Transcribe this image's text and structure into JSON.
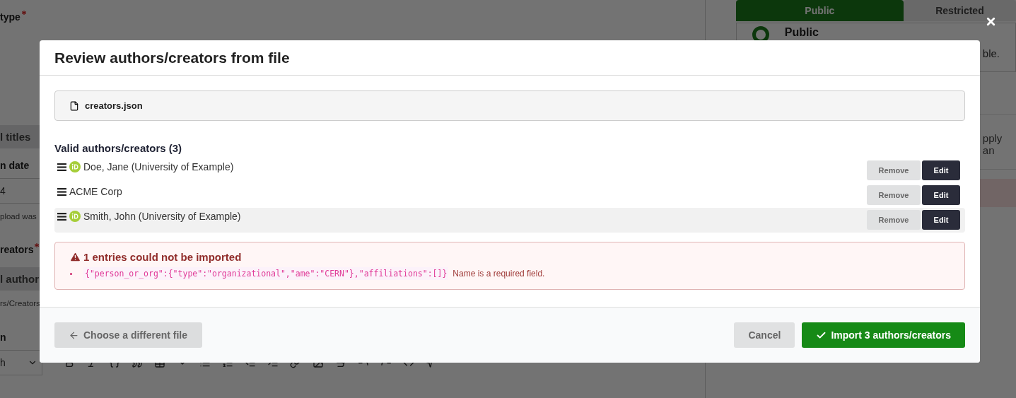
{
  "background": {
    "form_fragments": [
      {
        "kind": "label",
        "text": "type",
        "required": true
      },
      {
        "kind": "button",
        "text": "l titles",
        "required": false
      },
      {
        "kind": "label",
        "text": "n date",
        "required": false
      },
      {
        "kind": "input",
        "text": "4",
        "required": false
      },
      {
        "kind": "help",
        "text": "pload was",
        "required": false
      },
      {
        "kind": "label",
        "text": "reators",
        "required": true
      },
      {
        "kind": "button",
        "text": "l author",
        "required": false
      },
      {
        "kind": "help",
        "text": "rs/Creators",
        "required": false
      },
      {
        "kind": "label",
        "text": "n",
        "required": false
      },
      {
        "kind": "select",
        "text": "h",
        "required": false
      }
    ],
    "access_panel": {
      "tabs": [
        {
          "label": "Public",
          "selected": true
        },
        {
          "label": "Restricted",
          "selected": false
        }
      ],
      "option_title": "Public",
      "option_text": "ble.",
      "note": "pply an"
    }
  },
  "modal": {
    "title": "Review authors/creators from file",
    "file_name": "creators.json",
    "section_title": "Valid authors/creators (3)",
    "creators": [
      {
        "name": "Doe, Jane (University of Example)",
        "orcid": true,
        "selected": false,
        "remove_label": "Remove",
        "edit_label": "Edit"
      },
      {
        "name": "ACME Corp",
        "orcid": false,
        "selected": false,
        "remove_label": "Remove",
        "edit_label": "Edit"
      },
      {
        "name": "Smith, John (University of Example)",
        "orcid": true,
        "selected": true,
        "remove_label": "Remove",
        "edit_label": "Edit"
      }
    ],
    "error": {
      "title": "1 entries could not be imported",
      "items": [
        {
          "code": "{\"person_or_org\":{\"type\":\"organizational\",\"ame\":\"CERN\"},\"affiliations\":[]}",
          "message": "Name is a required field."
        }
      ]
    },
    "footer": {
      "back": "Choose a different file",
      "cancel": "Cancel",
      "import": "Import 3 authors/creators"
    }
  }
}
